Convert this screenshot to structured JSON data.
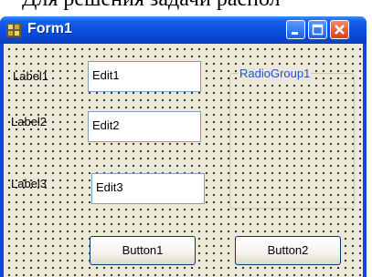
{
  "doc_text": "Для решения задачи распол",
  "window": {
    "title": "Form1",
    "controls": {
      "minimize_icon": "minimize-icon",
      "maximize_icon": "maximize-icon",
      "close_icon": "close-icon"
    }
  },
  "form": {
    "labels": [
      "Label1",
      "Label2",
      "Label3"
    ],
    "edits": [
      "Edit1",
      "Edit2",
      "Edit3"
    ],
    "radiogroup_caption": "RadioGroup1",
    "buttons": [
      "Button1",
      "Button2"
    ]
  },
  "colors": {
    "titlebar": "#0a50e0",
    "client_bg": "#ece9d8",
    "radiogroup_caption": "#2050d0",
    "close_button": "#d8401a"
  }
}
